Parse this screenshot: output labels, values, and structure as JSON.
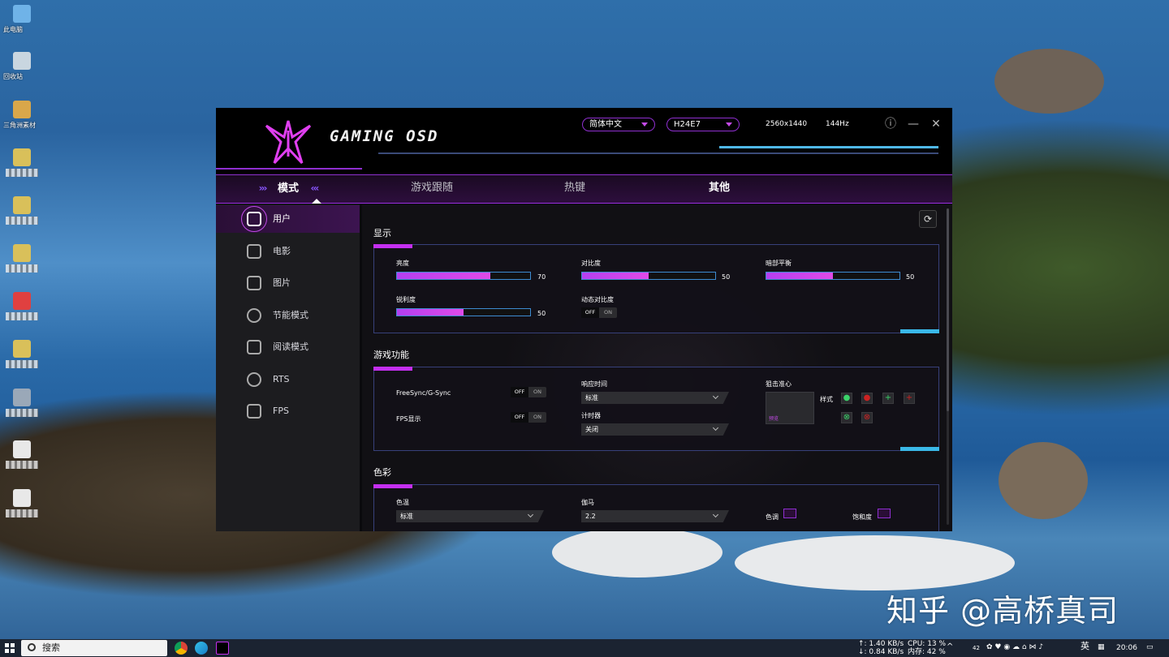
{
  "desktop": {
    "icons": [
      {
        "label": "此电脑",
        "icon": "computer-icon",
        "blurred": false
      },
      {
        "label": "回收站",
        "icon": "recycle-bin-icon",
        "blurred": false
      },
      {
        "label": "三角洲素材",
        "icon": "folder-icon",
        "blurred": false
      },
      {
        "label": "",
        "icon": "file-icon",
        "blurred": true
      },
      {
        "label": "",
        "icon": "file-icon",
        "blurred": true
      },
      {
        "label": "",
        "icon": "file-icon",
        "blurred": true
      },
      {
        "label": "",
        "icon": "file-icon",
        "blurred": true
      },
      {
        "label": "",
        "icon": "file-icon",
        "blurred": true
      },
      {
        "label": "",
        "icon": "file-icon",
        "blurred": true
      },
      {
        "label": "",
        "icon": "file-icon",
        "blurred": true
      },
      {
        "label": "",
        "icon": "file-icon",
        "blurred": true
      }
    ],
    "watermark": "知乎 @高桥真司"
  },
  "app": {
    "logo_text": "GAMING OSD",
    "language": "简体中文",
    "monitor": "H24E7",
    "resolution": "2560x1440",
    "refresh_rate": "144Hz",
    "accent": "#c42ff0",
    "accent2": "#3ab8e8",
    "tabs": [
      {
        "label": "模式",
        "active": true
      },
      {
        "label": "游戏跟随",
        "active": false
      },
      {
        "label": "热键",
        "active": false
      },
      {
        "label": "其他",
        "active": false
      }
    ],
    "sidebar": [
      {
        "label": "用户",
        "icon": "user-icon",
        "active": true
      },
      {
        "label": "电影",
        "icon": "movie-icon",
        "active": false
      },
      {
        "label": "图片",
        "icon": "picture-icon",
        "active": false
      },
      {
        "label": "节能模式",
        "icon": "eco-icon",
        "active": false
      },
      {
        "label": "阅读模式",
        "icon": "reading-icon",
        "active": false
      },
      {
        "label": "RTS",
        "icon": "rts-icon",
        "active": false
      },
      {
        "label": "FPS",
        "icon": "fps-icon",
        "active": false
      }
    ],
    "display": {
      "title": "显示",
      "brightness": {
        "label": "亮度",
        "value": 70
      },
      "contrast": {
        "label": "对比度",
        "value": 50
      },
      "dark_balance": {
        "label": "暗部平衡",
        "value": 50
      },
      "sharpness": {
        "label": "锐利度",
        "value": 50
      },
      "dynamic_contrast": {
        "label": "动态对比度",
        "off": "OFF",
        "on": "ON",
        "state": "OFF"
      }
    },
    "gaming": {
      "title": "游戏功能",
      "freesync": {
        "label": "FreeSync/G-Sync",
        "off": "OFF",
        "on": "ON",
        "state": "OFF"
      },
      "fps_display": {
        "label": "FPS显示",
        "off": "OFF",
        "on": "ON",
        "state": "OFF"
      },
      "response_time": {
        "label": "响应时间",
        "value": "标准"
      },
      "timer": {
        "label": "计时器",
        "value": "关闭"
      },
      "crosshair": {
        "label": "狙击准心",
        "style_label": "样式",
        "preview": "预览"
      }
    },
    "color": {
      "title": "色彩",
      "color_temp": {
        "label": "色温",
        "value": "标准"
      },
      "gamma": {
        "label": "伽马",
        "value": "2.2"
      },
      "hue": {
        "label": "色调"
      },
      "saturation": {
        "label": "饱和度"
      }
    }
  },
  "taskbar": {
    "search_placeholder": "搜索",
    "net_up": "↑: 1.40 KB/s",
    "net_down": "↓: 0.84 KB/s",
    "cpu": "CPU: 13 %",
    "memory": "内存: 42 %",
    "tray_num": "42",
    "ime": "英",
    "time": "20:06"
  }
}
